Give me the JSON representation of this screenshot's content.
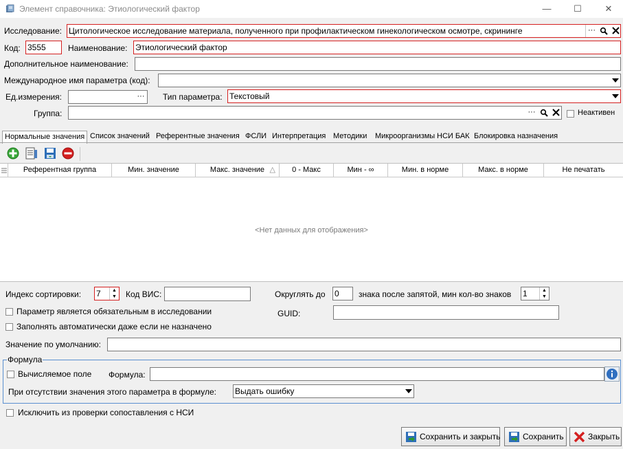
{
  "window": {
    "title": "Элемент справочника: Этиологический фактор",
    "minimize": "—",
    "maximize": "☐",
    "close": "✕"
  },
  "form": {
    "research_label": "Исследование:",
    "research_value": "Цитологическое исследование материала, полученного при профилактическом гинекологическом осмотре, скрининге",
    "code_label": "Код:",
    "code_value": "3555",
    "name_label": "Наименование:",
    "name_value": "Этиологический фактор",
    "extra_name_label": "Дополнительное наименование:",
    "extra_name_value": "",
    "intl_name_label": "Международное имя параметра (код):",
    "intl_name_value": "",
    "unit_label": "Ед.измерения:",
    "unit_value": "",
    "param_type_label": "Тип параметра:",
    "param_type_value": "Текстовый",
    "group_label": "Группа:",
    "group_value": "",
    "inactive_label": "Неактивен",
    "inactive_checked": false
  },
  "tabs": [
    {
      "label": "Нормальные значения",
      "active": true
    },
    {
      "label": "Список значений",
      "active": false
    },
    {
      "label": "Референтные значения",
      "active": false
    },
    {
      "label": "ФСЛИ",
      "active": false
    },
    {
      "label": "Интерпретация",
      "active": false
    },
    {
      "label": "Методики",
      "active": false
    },
    {
      "label": "Микроорганизмы",
      "active": false
    },
    {
      "label": "НСИ БАК",
      "active": false
    },
    {
      "label": "Блокировка назначения",
      "active": false
    }
  ],
  "toolbar": {
    "icons": [
      "add-icon",
      "edit-list-icon",
      "save-disk-icon",
      "delete-icon"
    ]
  },
  "grid": {
    "columns": [
      "Референтная группа",
      "Мин. значение",
      "Макс. значение",
      "0 - Макс",
      "Мин - ∞",
      "Мин. в норме",
      "Макс. в норме",
      "Не печатать"
    ],
    "sort_indicator": "△",
    "empty_text": "<Нет данных для отображения>"
  },
  "lower": {
    "sort_index_label": "Индекс сортировки:",
    "sort_index_value": "7",
    "vis_code_label": "Код ВИС:",
    "vis_code_value": "",
    "round_label": "Округлять до",
    "round_value": "0",
    "decimals_label": "знака после запятой, мин кол-во знаков",
    "decimals_value": "1",
    "mandatory_label": "Параметр является обязательным в исследовании",
    "autofill_label": "Заполнять автоматически даже если не назначено",
    "guid_label": "GUID:",
    "guid_value": "",
    "default_label": "Значение по умолчанию:",
    "default_value": ""
  },
  "formula": {
    "legend": "Формула",
    "computed_label": "Вычисляемое поле",
    "formula_label": "Формула:",
    "formula_value": "",
    "missing_label": "При отсутствии значения этого параметра в формуле:",
    "missing_value": "Выдать ошибку"
  },
  "exclude_label": "Исключить из проверки сопоставления с НСИ",
  "buttons": {
    "save_close": "Сохранить и закрыть",
    "save": "Сохранить",
    "close": "Закрыть"
  },
  "colors": {
    "required_border": "#d42020",
    "fieldset_border": "#5a8fd0",
    "add_green": "#3aa83a",
    "delete_red": "#d42020"
  }
}
